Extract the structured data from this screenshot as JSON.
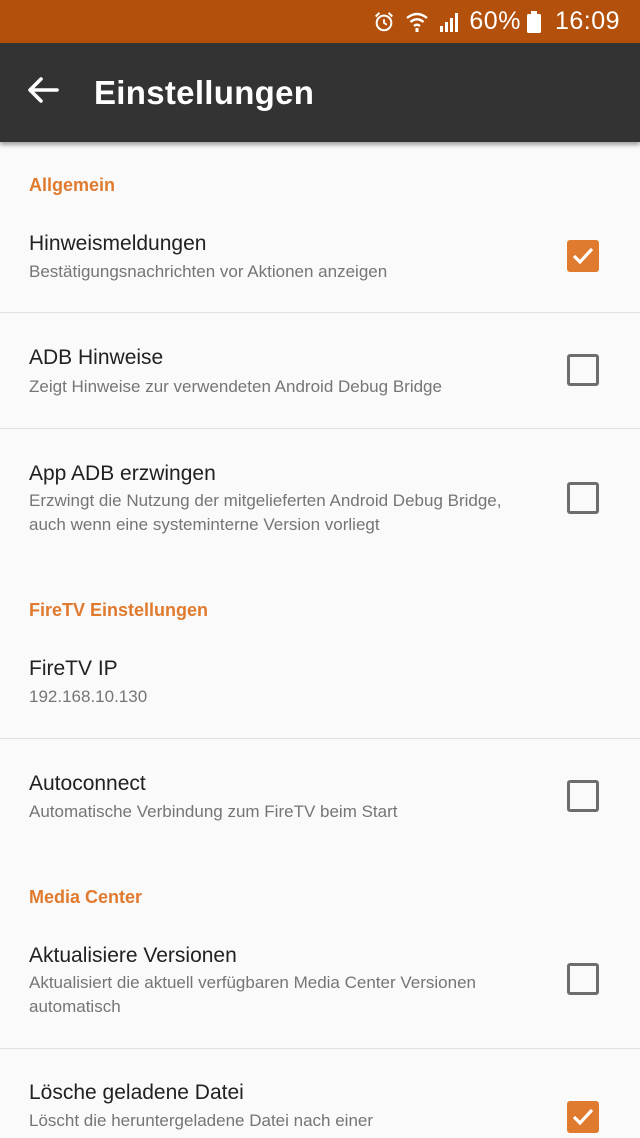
{
  "status_bar": {
    "battery_percent": "60%",
    "time": "16:09",
    "icons": [
      "alarm-icon",
      "wifi-icon",
      "signal-icon",
      "battery-icon"
    ]
  },
  "app_bar": {
    "title": "Einstellungen",
    "back_icon": "arrow-back-icon"
  },
  "colors": {
    "status_bar": "#b3510c",
    "app_bar": "#333333",
    "accent": "#e07a2e",
    "background": "#fafafa"
  },
  "sections": {
    "general": "Allgemein",
    "firetv": "FireTV Einstellungen",
    "media_center": "Media Center"
  },
  "prefs": {
    "hints": {
      "title": "Hinweismeldungen",
      "subtitle": "Bestätigungsnachrichten vor Aktionen anzeigen",
      "checked": true
    },
    "adb_hints": {
      "title": "ADB Hinweise",
      "subtitle": "Zeigt Hinweise zur verwendeten Android Debug Bridge",
      "checked": false
    },
    "force_app_adb": {
      "title": "App ADB erzwingen",
      "subtitle": "Erzwingt die Nutzung der mitgelieferten Android Debug Bridge, auch wenn eine systeminterne Version vorliegt",
      "checked": false
    },
    "firetv_ip": {
      "title": "FireTV IP",
      "value": "192.168.10.130"
    },
    "autoconnect": {
      "title": "Autoconnect",
      "subtitle": "Automatische Verbindung zum FireTV beim Start",
      "checked": false
    },
    "update_versions": {
      "title": "Aktualisiere Versionen",
      "subtitle": "Aktualisiert die aktuell verfügbaren Media Center Versionen automatisch",
      "checked": false
    },
    "delete_downloaded": {
      "title": "Lösche geladene Datei",
      "subtitle": "Löscht die heruntergeladene Datei nach einer",
      "checked": true
    }
  }
}
